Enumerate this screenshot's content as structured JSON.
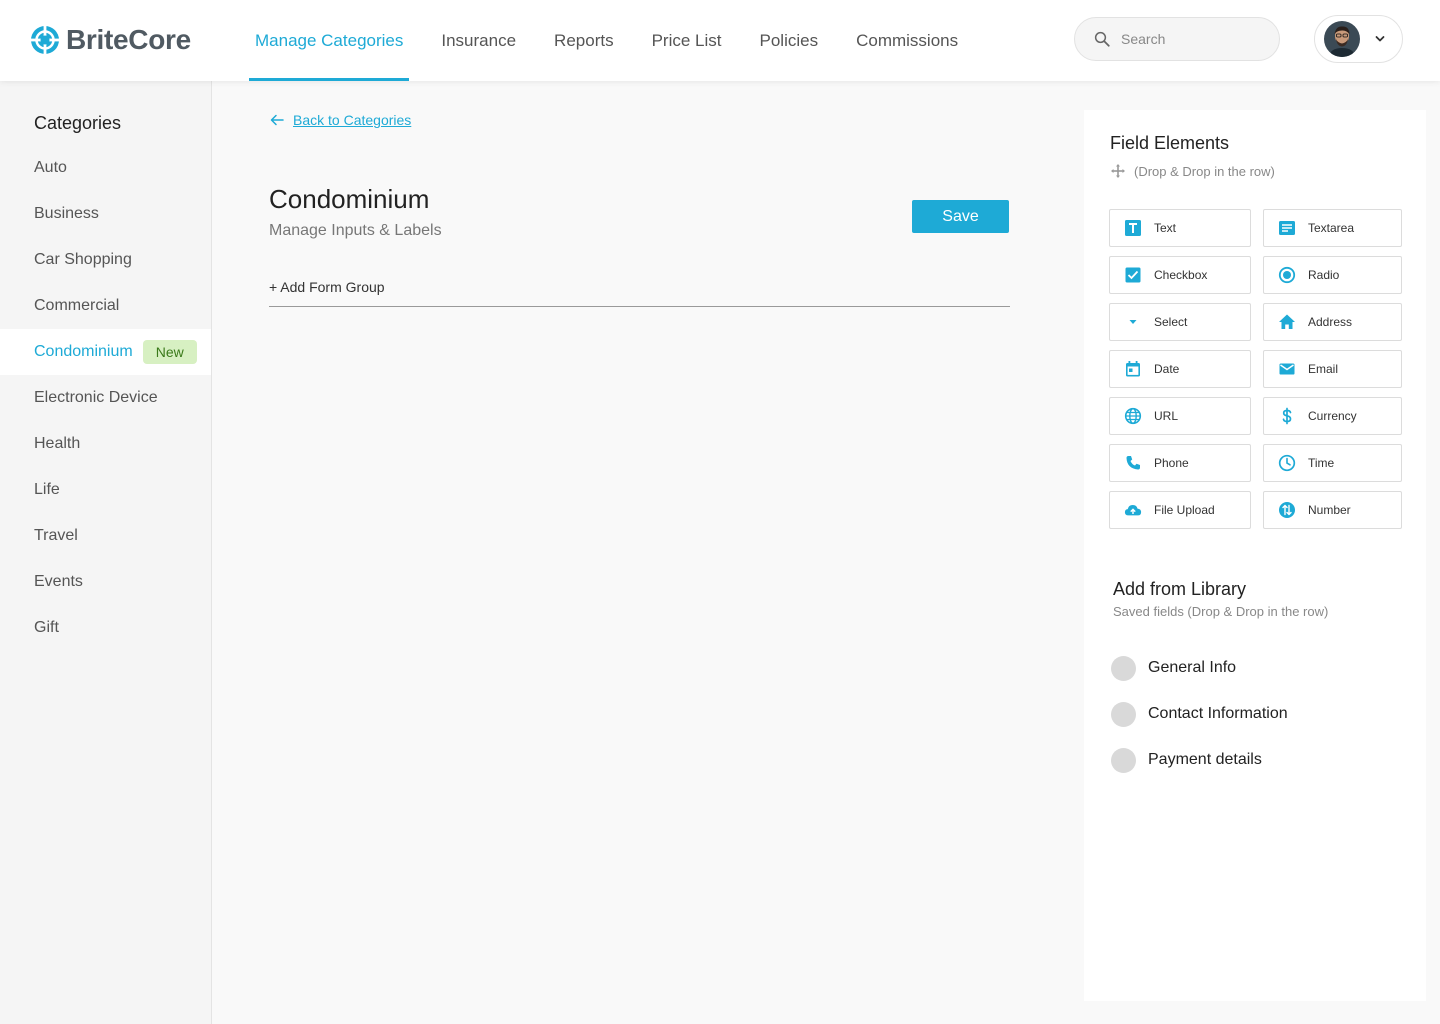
{
  "brand": {
    "name": "BriteCore",
    "accent": "#1eaad6"
  },
  "nav": {
    "items": [
      {
        "label": "Manage Categories",
        "active": true
      },
      {
        "label": "Insurance"
      },
      {
        "label": "Reports"
      },
      {
        "label": "Price List"
      },
      {
        "label": "Policies"
      },
      {
        "label": "Commissions"
      }
    ]
  },
  "search": {
    "placeholder": "Search",
    "value": ""
  },
  "user": {
    "icon": "chevron-down-icon"
  },
  "sidebar": {
    "title": "Categories",
    "items": [
      {
        "label": "Auto"
      },
      {
        "label": "Business"
      },
      {
        "label": "Car Shopping"
      },
      {
        "label": "Commercial"
      },
      {
        "label": "Condominium",
        "badge": "New",
        "active": true
      },
      {
        "label": "Electronic Device"
      },
      {
        "label": "Health"
      },
      {
        "label": "Life"
      },
      {
        "label": "Travel"
      },
      {
        "label": "Events"
      },
      {
        "label": "Gift"
      }
    ]
  },
  "main": {
    "back_label": "Back to Categories",
    "title": "Condominium",
    "subtitle": "Manage Inputs & Labels",
    "save_label": "Save",
    "add_group_label": "+ Add Form Group"
  },
  "panel": {
    "title": "Field Elements",
    "hint": "(Drop & Drop in the row)",
    "fields": [
      {
        "label": "Text",
        "icon": "text-icon"
      },
      {
        "label": "Textarea",
        "icon": "textarea-icon"
      },
      {
        "label": "Checkbox",
        "icon": "checkbox-icon"
      },
      {
        "label": "Radio",
        "icon": "radio-icon"
      },
      {
        "label": "Select",
        "icon": "select-icon"
      },
      {
        "label": "Address",
        "icon": "home-icon"
      },
      {
        "label": "Date",
        "icon": "calendar-icon"
      },
      {
        "label": "Email",
        "icon": "mail-icon"
      },
      {
        "label": "URL",
        "icon": "globe-icon"
      },
      {
        "label": "Currency",
        "icon": "dollar-icon"
      },
      {
        "label": "Phone",
        "icon": "phone-icon"
      },
      {
        "label": "Time",
        "icon": "clock-icon"
      },
      {
        "label": "File Upload",
        "icon": "cloud-upload-icon"
      },
      {
        "label": "Number",
        "icon": "number-icon"
      }
    ],
    "library_title": "Add from Library",
    "library_hint": "Saved fields (Drop & Drop in the row)",
    "library_items": [
      {
        "label": "General Info"
      },
      {
        "label": "Contact Information"
      },
      {
        "label": "Payment details"
      }
    ]
  }
}
